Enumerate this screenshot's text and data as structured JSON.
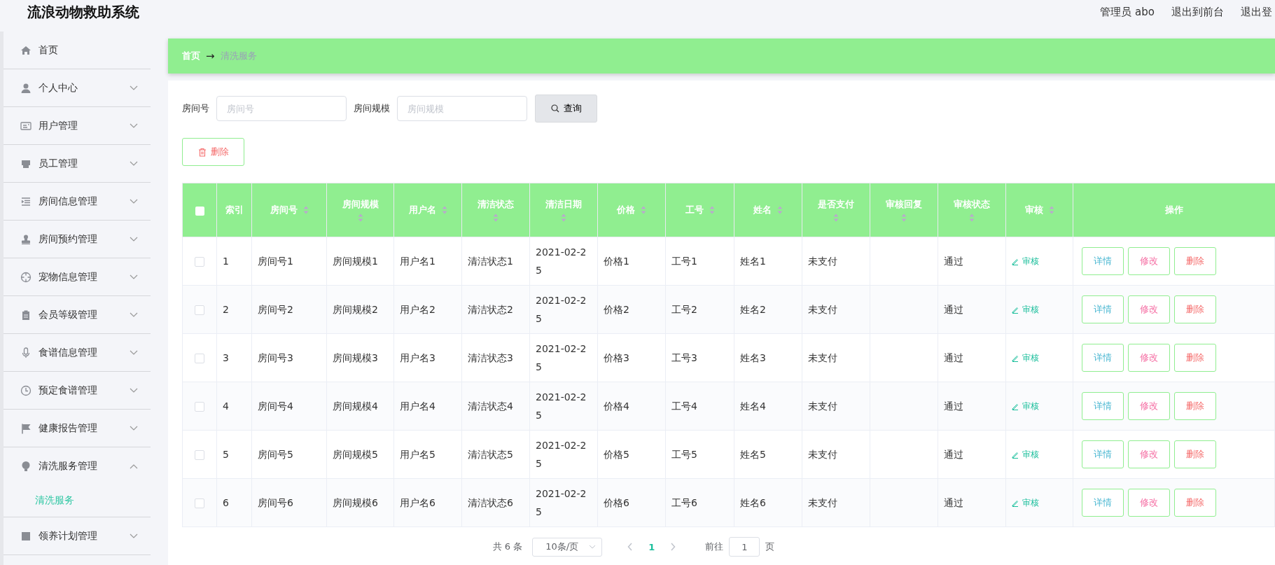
{
  "app": {
    "title": "流浪动物救助系统"
  },
  "header": {
    "user": "管理员 abo",
    "links": [
      "退出到前台",
      "退出登"
    ]
  },
  "sidebar": {
    "items": [
      {
        "label": "首页",
        "kind": "link"
      },
      {
        "label": "个人中心",
        "kind": "submenu",
        "expanded": false
      },
      {
        "label": "用户管理",
        "kind": "submenu",
        "expanded": false
      },
      {
        "label": "员工管理",
        "kind": "submenu",
        "expanded": false
      },
      {
        "label": "房间信息管理",
        "kind": "submenu",
        "expanded": false
      },
      {
        "label": "房间预约管理",
        "kind": "submenu",
        "expanded": false
      },
      {
        "label": "宠物信息管理",
        "kind": "submenu",
        "expanded": false
      },
      {
        "label": "会员等级管理",
        "kind": "submenu",
        "expanded": false
      },
      {
        "label": "食谱信息管理",
        "kind": "submenu",
        "expanded": false
      },
      {
        "label": "预定食谱管理",
        "kind": "submenu",
        "expanded": false
      },
      {
        "label": "健康报告管理",
        "kind": "submenu",
        "expanded": false
      },
      {
        "label": "清洗服务管理",
        "kind": "submenu",
        "expanded": true,
        "children": [
          {
            "label": "清洗服务",
            "selected": true
          }
        ]
      },
      {
        "label": "领养计划管理",
        "kind": "submenu",
        "expanded": false
      }
    ]
  },
  "breadcrumb": {
    "items": [
      "首页",
      "清洗服务"
    ],
    "separator": "→"
  },
  "search": {
    "fields": [
      {
        "label": "房间号",
        "placeholder": "房间号"
      },
      {
        "label": "房间规模",
        "placeholder": "房间规模"
      }
    ],
    "button": "查询"
  },
  "toolbar": {
    "delete": "删除"
  },
  "table": {
    "select_all": {
      "checked": false
    },
    "columns": [
      {
        "label": "索引",
        "sortable": false
      },
      {
        "label": "房间号",
        "sortable": true
      },
      {
        "label": "房间规模",
        "sortable": true
      },
      {
        "label": "用户名",
        "sortable": true
      },
      {
        "label": "清洁状态",
        "sortable": true
      },
      {
        "label": "清洁日期",
        "sortable": true
      },
      {
        "label": "价格",
        "sortable": true
      },
      {
        "label": "工号",
        "sortable": true
      },
      {
        "label": "姓名",
        "sortable": true
      },
      {
        "label": "是否支付",
        "sortable": true
      },
      {
        "label": "审核回复",
        "sortable": true
      },
      {
        "label": "审核状态",
        "sortable": true
      },
      {
        "label": "审核",
        "sortable": true
      },
      {
        "label": "操作",
        "sortable": false
      }
    ],
    "rows": [
      {
        "checked": false,
        "cells": [
          "1",
          "房间号1",
          "房间规模1",
          "用户名1",
          "清洁状态1",
          "2021-02-25",
          "价格1",
          "工号1",
          "姓名1",
          "未支付",
          "",
          "通过"
        ],
        "review": "审核",
        "actions": [
          "详情",
          "修改",
          "删除"
        ]
      },
      {
        "checked": false,
        "cells": [
          "2",
          "房间号2",
          "房间规模2",
          "用户名2",
          "清洁状态2",
          "2021-02-25",
          "价格2",
          "工号2",
          "姓名2",
          "未支付",
          "",
          "通过"
        ],
        "review": "审核",
        "actions": [
          "详情",
          "修改",
          "删除"
        ]
      },
      {
        "checked": false,
        "cells": [
          "3",
          "房间号3",
          "房间规模3",
          "用户名3",
          "清洁状态3",
          "2021-02-25",
          "价格3",
          "工号3",
          "姓名3",
          "未支付",
          "",
          "通过"
        ],
        "review": "审核",
        "actions": [
          "详情",
          "修改",
          "删除"
        ]
      },
      {
        "checked": false,
        "cells": [
          "4",
          "房间号4",
          "房间规模4",
          "用户名4",
          "清洁状态4",
          "2021-02-25",
          "价格4",
          "工号4",
          "姓名4",
          "未支付",
          "",
          "通过"
        ],
        "review": "审核",
        "actions": [
          "详情",
          "修改",
          "删除"
        ]
      },
      {
        "checked": false,
        "cells": [
          "5",
          "房间号5",
          "房间规模5",
          "用户名5",
          "清洁状态5",
          "2021-02-25",
          "价格5",
          "工号5",
          "姓名5",
          "未支付",
          "",
          "通过"
        ],
        "review": "审核",
        "actions": [
          "详情",
          "修改",
          "删除"
        ]
      },
      {
        "checked": false,
        "cells": [
          "6",
          "房间号6",
          "房间规模6",
          "用户名6",
          "清洁状态6",
          "2021-02-25",
          "价格6",
          "工号6",
          "姓名6",
          "未支付",
          "",
          "通过"
        ],
        "review": "审核",
        "actions": [
          "详情",
          "修改",
          "删除"
        ]
      }
    ]
  },
  "pagination": {
    "total": "共 6 条",
    "page_size": "10条/页",
    "pages": [
      {
        "label": "1",
        "selected": true
      }
    ],
    "goto_label": "前往",
    "goto_value": "1",
    "goto_suffix": "页"
  }
}
